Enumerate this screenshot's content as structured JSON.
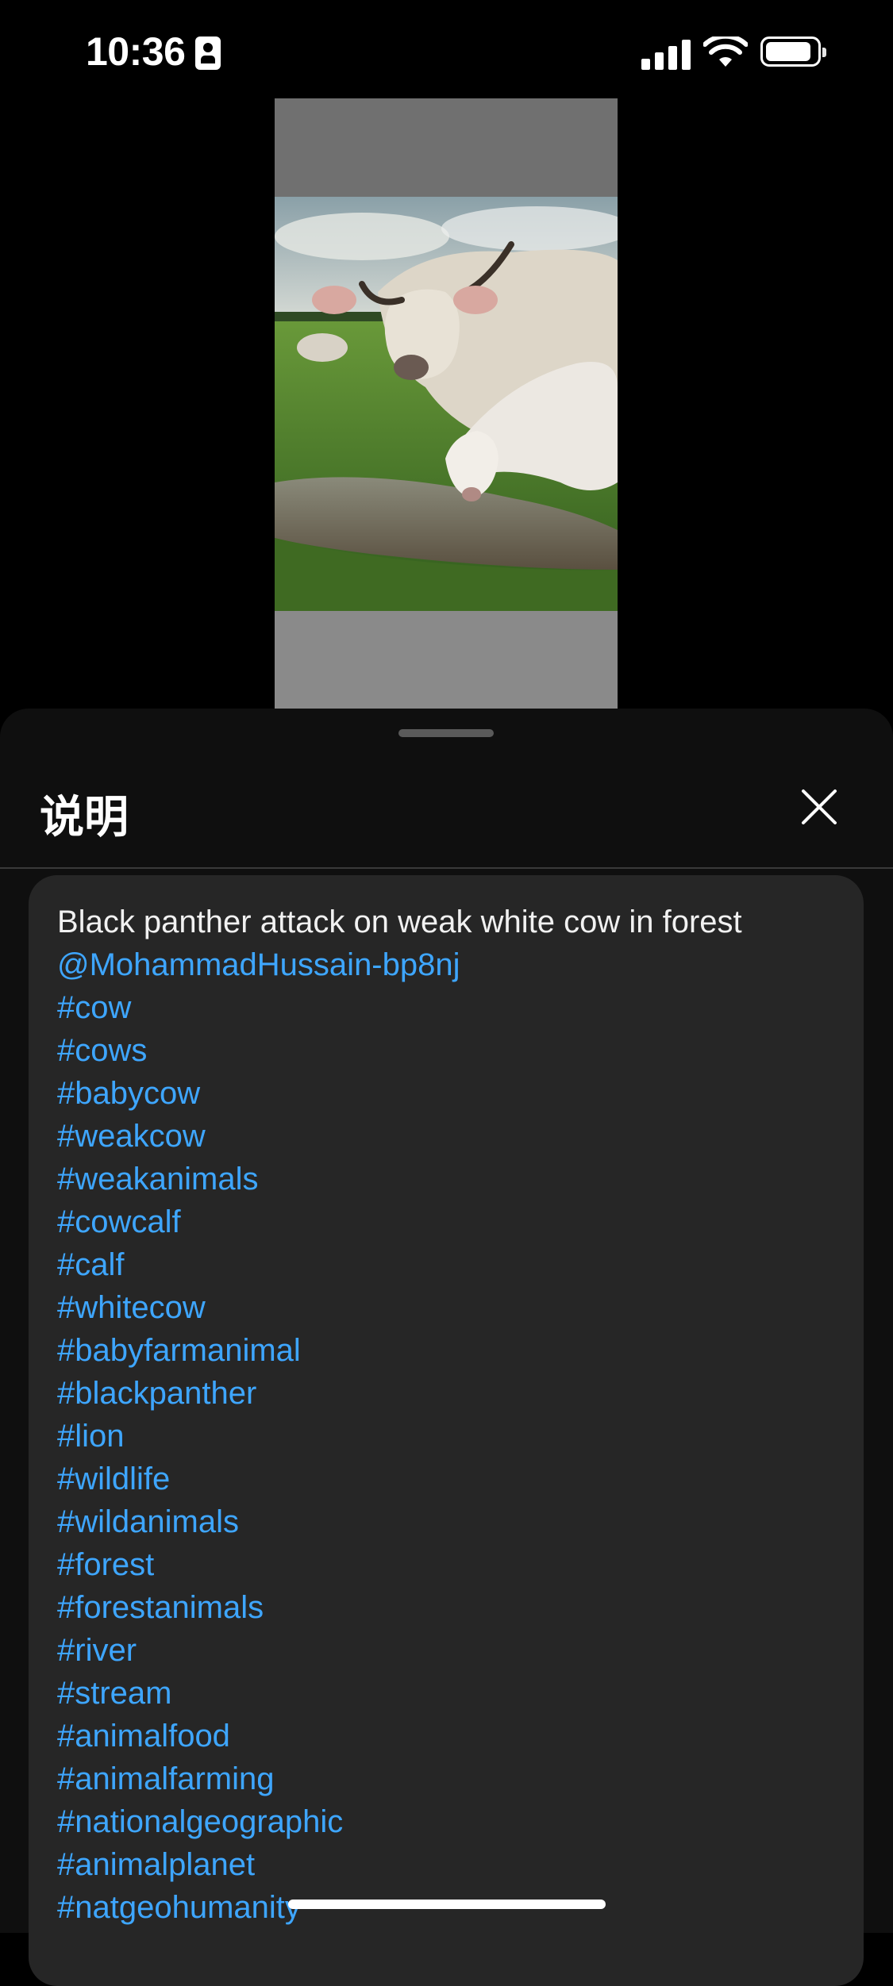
{
  "status_bar": {
    "time": "10:36"
  },
  "sheet": {
    "title": "说明",
    "description": "Black panther attack on weak white cow in forest",
    "mention": "@MohammadHussain-bp8nj",
    "hashtags": [
      "#cow",
      "#cows",
      "#babycow",
      "#weakcow",
      "#weakanimals",
      "#cowcalf",
      "#calf",
      "#whitecow",
      "#babyfarmanimal",
      "#blackpanther",
      "#lion",
      "#wildlife",
      "#wildanimals",
      "#forest",
      "#forestanimals",
      "#river",
      "#stream",
      "#animalfood",
      "#animalfarming",
      "#nationalgeographic",
      "#animalplanet",
      "#natgeohumanity"
    ]
  },
  "icons": {
    "close": "close-icon",
    "signal": "cellular-signal-icon",
    "wifi": "wifi-icon",
    "battery": "battery-icon",
    "badge": "contact-badge-icon"
  },
  "colors": {
    "link": "#3ea6ff",
    "sheet_bg": "#0f0f0f",
    "card_bg": "#262626"
  }
}
